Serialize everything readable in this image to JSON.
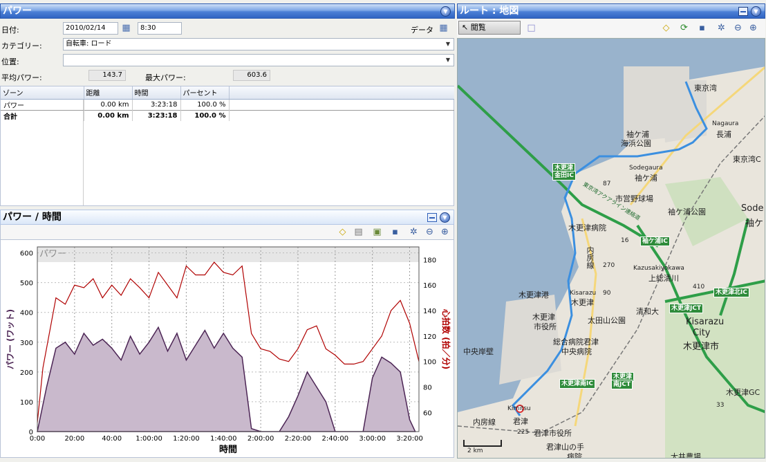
{
  "power_panel": {
    "title": "パワー",
    "date_label": "日付:",
    "date_value": "2010/02/14",
    "time_value": "8:30",
    "data_label": "データ",
    "category_label": "カテゴリー:",
    "category_value": "自転車: ロード",
    "location_label": "位置:",
    "avg_label": "平均パワー:",
    "avg_value": "143.7",
    "max_label": "最大パワー:",
    "max_value": "603.6"
  },
  "zones": {
    "headers": [
      "ゾーン",
      "距離",
      "時間",
      "パーセント"
    ],
    "rows": [
      [
        "パワー",
        "0.00 km",
        "3:23:18",
        "100.0 %"
      ]
    ],
    "total": [
      "合計",
      "0.00 km",
      "3:23:18",
      "100.0 %"
    ]
  },
  "chart_panel": {
    "title": "パワー / 時間",
    "watermark": "パワー"
  },
  "route_panel": {
    "title": "ルート : 地図",
    "browse_label": "閲覧",
    "scale_label": "2 km"
  },
  "map_labels": [
    "東京湾",
    "Nagaura",
    "長浦",
    "袖ケ浦",
    "海浜公園",
    "東京湾C",
    "木更津",
    "金田IC",
    "Sodegaura",
    "袖ケ浦",
    "87",
    "市営野球場",
    "袖ケ浦公園",
    "東京湾アクアライン連絡道",
    "木更津病院",
    "袖ケ浦IC",
    "16",
    "内房線",
    "270",
    "Kazusakiyokawa",
    "上総清川",
    "410",
    "木更津北IC",
    "90",
    "Kisarazu",
    "木更津",
    "木更津港",
    "清和大",
    "木更津JCT",
    "木更津",
    "市役所",
    "太田山公園",
    "Kisarazu",
    "City",
    "木更津市",
    "総合病院君津",
    "中央病院",
    "中央岸壁",
    "木更津南IC",
    "木更津",
    "南JCT",
    "木更津GC",
    "内房線",
    "Kimitsu",
    "君津",
    "君津市役所",
    "225",
    "君津山の手",
    "病院",
    "大井農場",
    "Sode",
    "袖ケ",
    "33"
  ],
  "chart_data": {
    "type": "line",
    "xlabel": "時間",
    "ylabel_left": "パワー (ワット)",
    "ylabel_right": "心拍数 (拍／分)",
    "x_ticks": [
      "0:00",
      "20:00",
      "40:00",
      "1:00:00",
      "1:20:00",
      "1:40:00",
      "2:00:00",
      "2:20:00",
      "2:40:00",
      "3:00:00",
      "3:20:00"
    ],
    "y_left_ticks": [
      0,
      100,
      200,
      300,
      400,
      500,
      600
    ],
    "y_right_ticks": [
      60,
      80,
      100,
      120,
      140,
      160,
      180
    ],
    "ylim_left": [
      0,
      620
    ],
    "ylim_right": [
      45,
      190
    ],
    "xlim_min": [
      0,
      205
    ],
    "series": [
      {
        "name": "パワー",
        "color": "#4b2454",
        "fill": "#c9b9cc",
        "x_min": [
          0,
          5,
          10,
          15,
          20,
          25,
          30,
          35,
          40,
          45,
          50,
          55,
          60,
          65,
          70,
          75,
          80,
          85,
          90,
          95,
          100,
          105,
          110,
          115,
          120,
          125,
          130,
          135,
          140,
          145,
          150,
          155,
          160,
          165,
          170,
          175,
          180,
          185,
          190,
          195,
          200,
          203
        ],
        "values": [
          0,
          150,
          280,
          300,
          260,
          330,
          290,
          310,
          280,
          240,
          320,
          260,
          300,
          350,
          270,
          330,
          240,
          290,
          340,
          280,
          330,
          280,
          250,
          10,
          0,
          0,
          0,
          50,
          120,
          200,
          150,
          100,
          0,
          0,
          0,
          0,
          180,
          250,
          230,
          200,
          40,
          0
        ]
      },
      {
        "name": "心拍数",
        "color": "#b00000",
        "x_min": [
          0,
          3,
          10,
          15,
          20,
          25,
          30,
          35,
          40,
          45,
          50,
          55,
          60,
          65,
          70,
          75,
          80,
          85,
          90,
          95,
          100,
          105,
          110,
          115,
          120,
          125,
          130,
          135,
          140,
          145,
          150,
          155,
          160,
          165,
          170,
          175,
          180,
          185,
          190,
          195,
          200,
          205
        ],
        "values": [
          52,
          95,
          150,
          145,
          160,
          158,
          165,
          150,
          160,
          152,
          165,
          158,
          150,
          170,
          160,
          150,
          175,
          168,
          168,
          178,
          170,
          168,
          175,
          122,
          110,
          108,
          102,
          100,
          110,
          125,
          128,
          110,
          105,
          98,
          98,
          100,
          110,
          120,
          140,
          148,
          130,
          100
        ]
      }
    ]
  }
}
